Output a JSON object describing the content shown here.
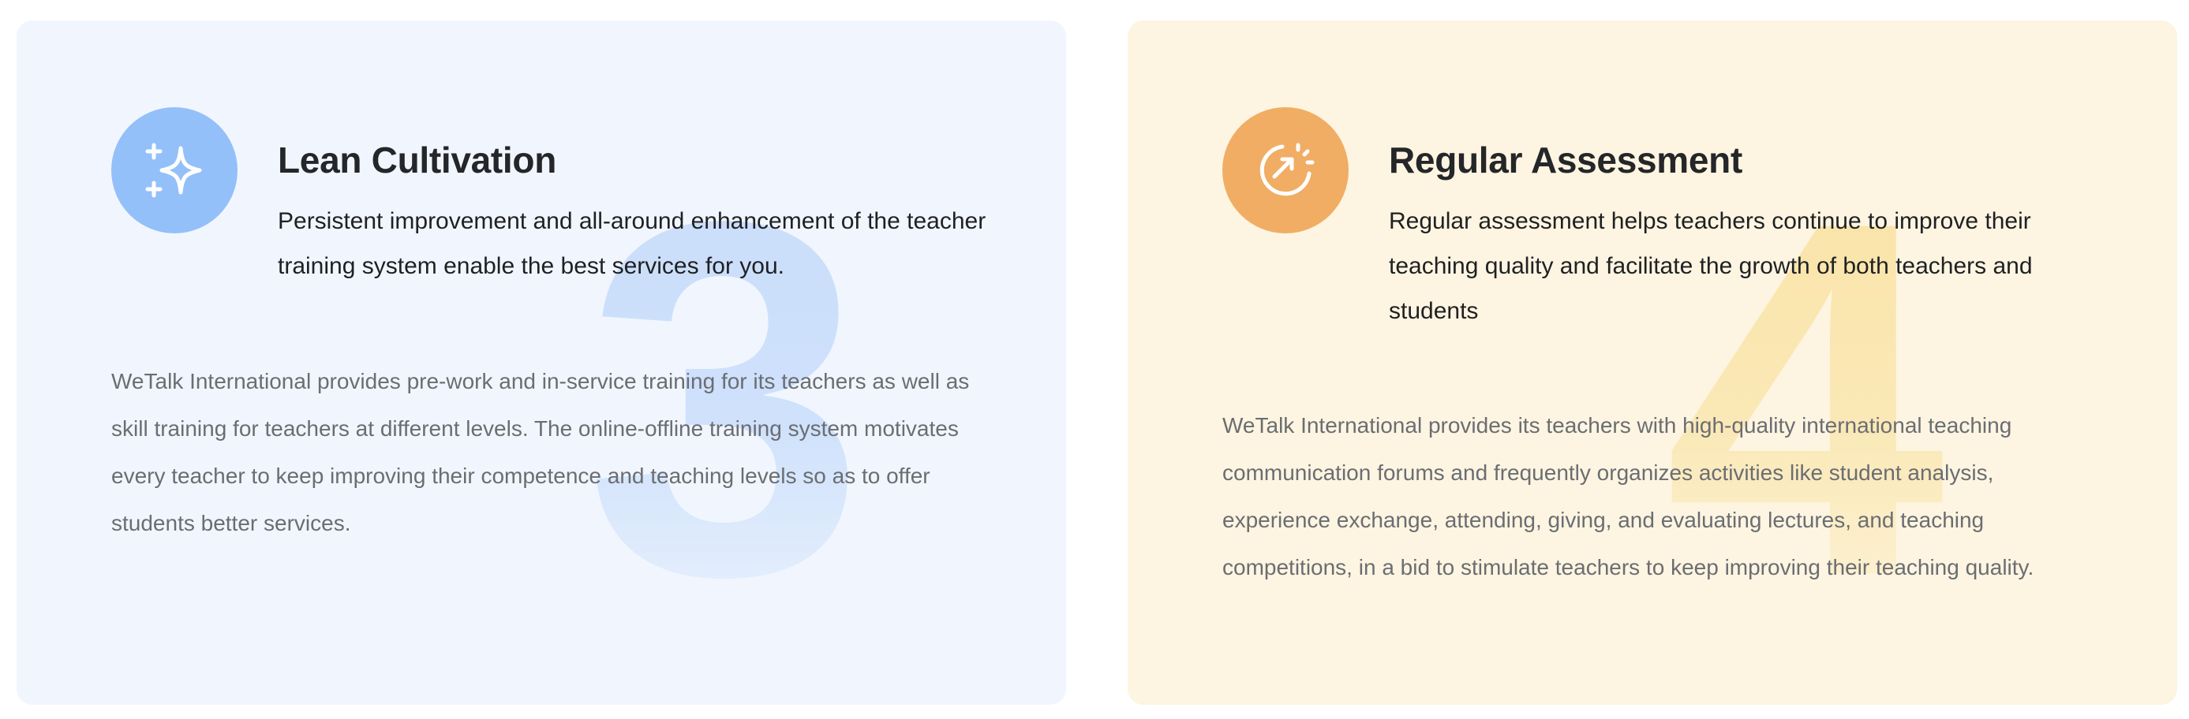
{
  "cards": [
    {
      "numeral": "3",
      "icon": "sparkle-icon",
      "icon_color": "#94c0f9",
      "background": "#f1f6fe",
      "title": "Lean Cultivation",
      "subtitle": "Persistent improvement and all-around enhancement of the teacher training system enable the best services for you.",
      "body": "WeTalk International provides pre-work and in-service training for its teachers as well as skill training for teachers at different levels. The online-offline training system motivates every teacher to keep improving their competence and teaching levels so as to offer students better services."
    },
    {
      "numeral": "4",
      "icon": "growth-gauge-icon",
      "icon_color": "#f1ad64",
      "background": "#fdf5e1",
      "title": "Regular Assessment",
      "subtitle": "Regular assessment helps teachers continue to improve their teaching quality and facilitate the growth of both teachers and students",
      "body": "WeTalk International provides its teachers with high-quality international teaching communication forums and frequently organizes activities like student analysis, experience exchange, attending, giving, and evaluating lectures, and teaching competitions, in a bid to stimulate teachers to keep improving their teaching quality."
    }
  ]
}
